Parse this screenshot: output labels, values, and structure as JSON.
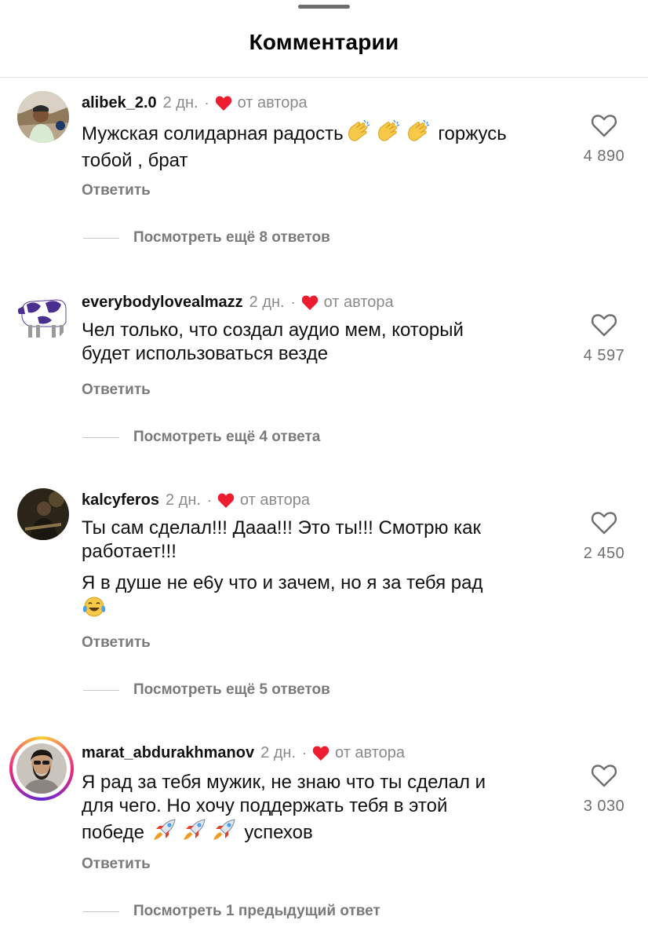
{
  "header": {
    "title": "Комментарии"
  },
  "labels": {
    "reply": "Ответить",
    "by_author": "от автора"
  },
  "colors": {
    "heart_red": "#ed1c2e",
    "muted": "#8a8a8a"
  },
  "comments": [
    {
      "username": "alibek_2.0",
      "time": "2 дн.",
      "lines": [
        "Мужская солидарная радость",
        "горжусь",
        "тобой , брат"
      ],
      "likes": "4 890",
      "more": "Посмотреть ещё 8 ответов",
      "emojis": [
        "clapping-hands",
        "clapping-hands",
        "clapping-hands"
      ]
    },
    {
      "username": "everybodylovealmazz",
      "time": "2 дн.",
      "lines": [
        "Чел только, что создал аудио мем, который",
        "будет использоваться везде"
      ],
      "likes": "4 597",
      "more": "Посмотреть ещё 4 ответа"
    },
    {
      "username": "kalcyferos",
      "time": "2 дн.",
      "lines": [
        "Ты сам сделал!!! Дааа!!! Это ты!!! Смотрю как",
        "работает!!!",
        "Я в душе не е6у что и зачем, но я за тебя рад"
      ],
      "likes": "2 450",
      "more": "Посмотреть ещё 5 ответов",
      "emojis": [
        "tears-of-joy"
      ]
    },
    {
      "username": "marat_abdurakhmanov",
      "time": "2 дн.",
      "lines": [
        "Я рад за тебя мужик, не знаю что ты сделал и",
        "для чего. Но хочу поддержать тебя в этой",
        "победе",
        "успехов"
      ],
      "likes": "3 030",
      "more": "Посмотреть 1 предыдущий ответ",
      "emojis": [
        "rocket",
        "rocket",
        "rocket"
      ]
    }
  ]
}
